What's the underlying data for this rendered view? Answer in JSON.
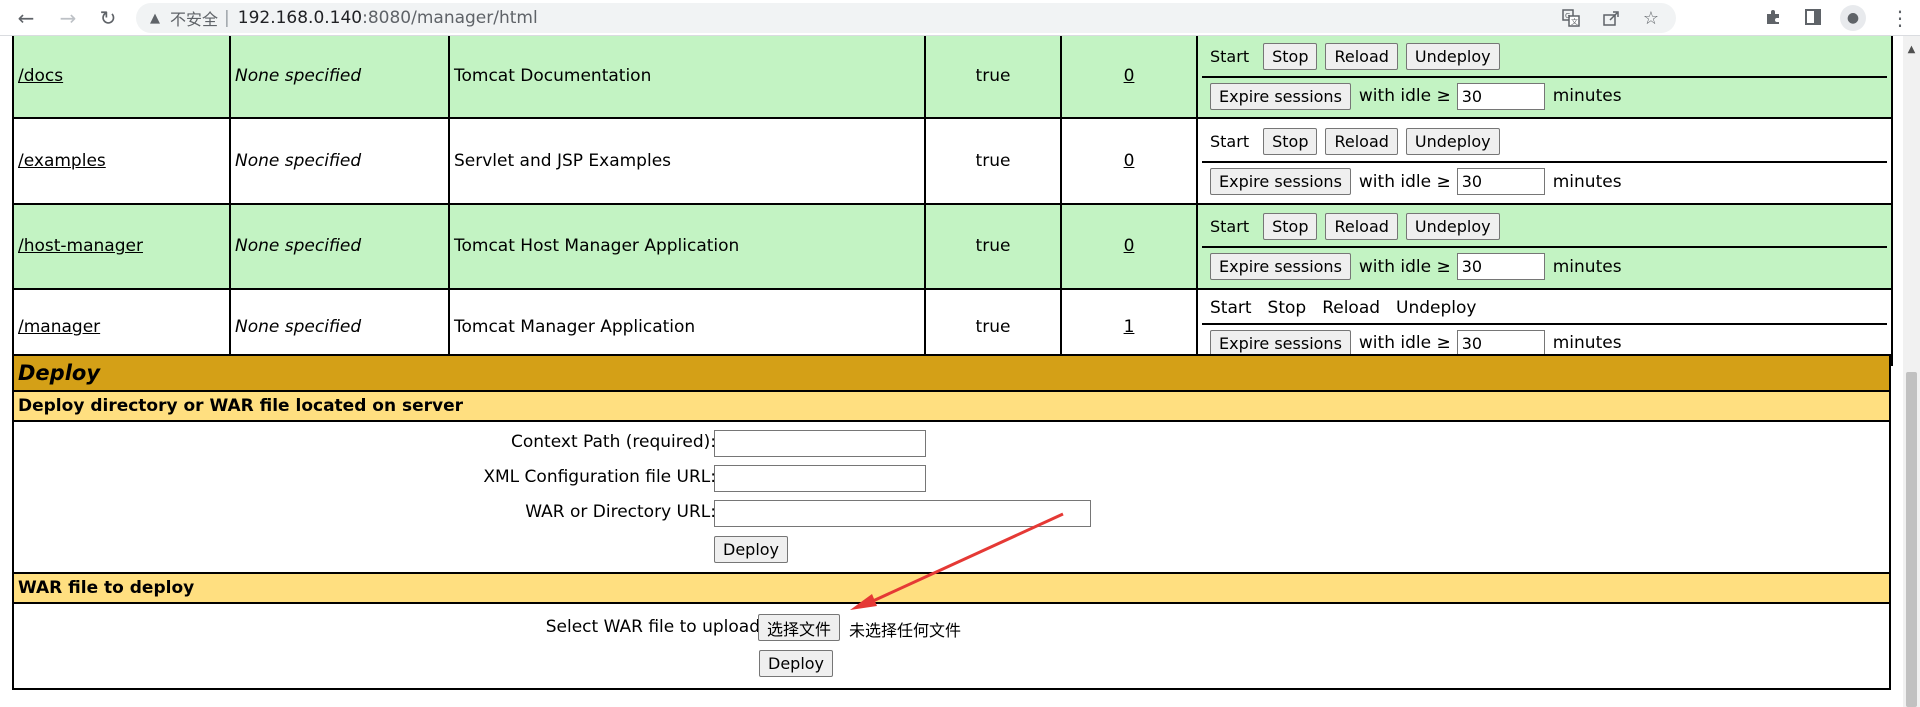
{
  "browser": {
    "insecure_label": "不安全",
    "separator": "|",
    "url_host": "192.168.0.140",
    "url_rest": ":8080/manager/html"
  },
  "apps": [
    {
      "path": "/docs",
      "version": "None specified",
      "display_name": "Tomcat Documentation",
      "running": "true",
      "sessions": "0",
      "row_style": "green",
      "links_as_buttons": true
    },
    {
      "path": "/examples",
      "version": "None specified",
      "display_name": "Servlet and JSP Examples",
      "running": "true",
      "sessions": "0",
      "row_style": "white",
      "links_as_buttons": true
    },
    {
      "path": "/host-manager",
      "version": "None specified",
      "display_name": "Tomcat Host Manager Application",
      "running": "true",
      "sessions": "0",
      "row_style": "green",
      "links_as_buttons": true
    },
    {
      "path": "/manager",
      "version": "None specified",
      "display_name": "Tomcat Manager Application",
      "running": "true",
      "sessions": "1",
      "row_style": "white",
      "links_as_buttons": false
    }
  ],
  "commands": {
    "start": "Start",
    "stop": "Stop",
    "reload": "Reload",
    "undeploy": "Undeploy",
    "expire": "Expire sessions",
    "with_idle": "with idle ≥",
    "idle_value": "30",
    "minutes": "minutes"
  },
  "deploy": {
    "title": "Deploy",
    "server_heading": "Deploy directory or WAR file located on server",
    "context_path_label": "Context Path (required):",
    "xml_config_label": "XML Configuration file URL:",
    "war_dir_label": "WAR or Directory URL:",
    "deploy_button": "Deploy",
    "war_heading": "WAR file to deploy",
    "select_label": "Select WAR file to upload",
    "choose_file_button": "选择文件",
    "no_file_text": "未选择任何文件",
    "upload_deploy_button": "Deploy"
  },
  "annotation": {
    "color": "#e53935"
  }
}
